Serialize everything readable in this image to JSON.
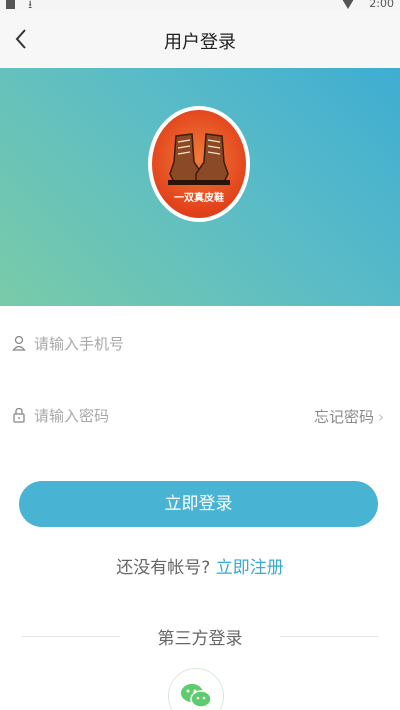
{
  "status_bar": {
    "time": "2:00"
  },
  "nav": {
    "title": "用户登录"
  },
  "logo": {
    "text": "一双真皮鞋"
  },
  "form": {
    "phone_placeholder": "请输入手机号",
    "password_placeholder": "请输入密码",
    "forgot_label": "忘记密码",
    "forgot_chevron": "›"
  },
  "login_button": {
    "label": "立即登录"
  },
  "register": {
    "prompt": "还没有帐号?",
    "link": "立即注册"
  },
  "third_party": {
    "title": "第三方登录",
    "providers": [
      "wechat-icon"
    ]
  },
  "colors": {
    "accent": "#49b3d3",
    "link": "#3aa8cf",
    "hero_start": "#3fadd2",
    "hero_end": "#79cba8",
    "logo_bg": "#e2421b",
    "wechat": "#5dcb6e"
  }
}
